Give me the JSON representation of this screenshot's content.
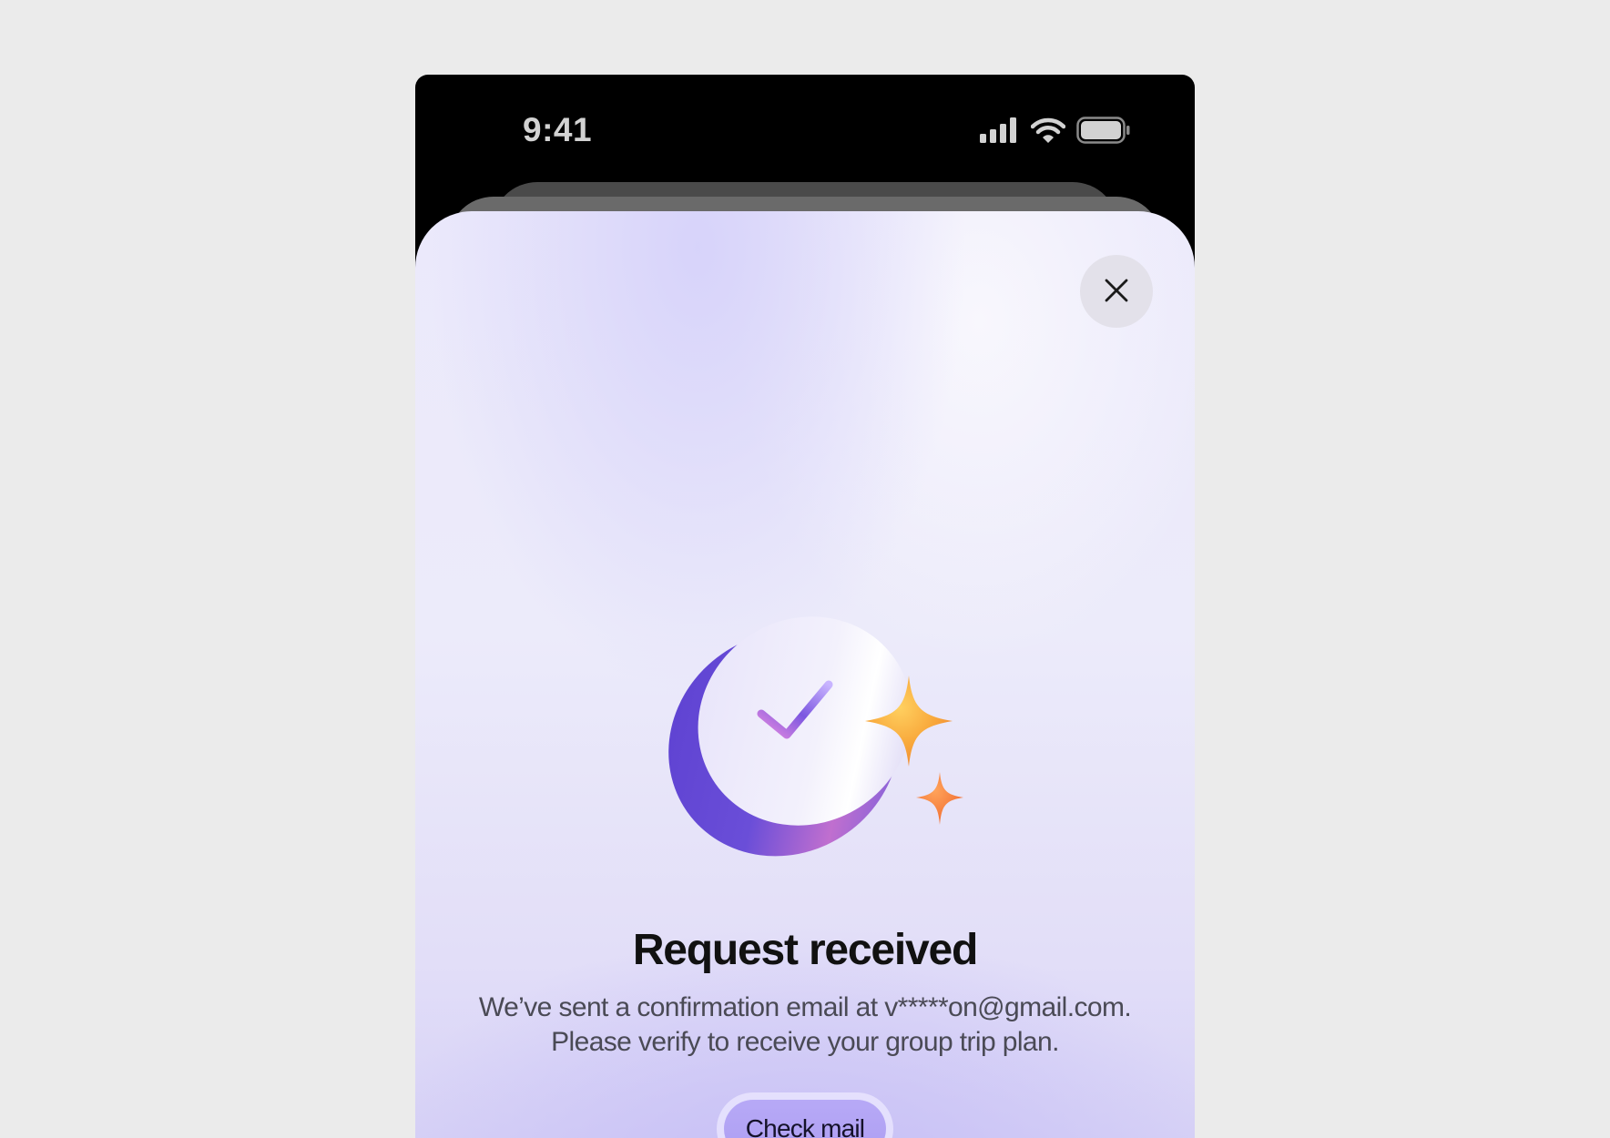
{
  "status_bar": {
    "time": "9:41",
    "icons": [
      "cellular-signal-icon",
      "wifi-icon",
      "battery-icon"
    ]
  },
  "modal": {
    "close_icon": "close-icon",
    "illustration": "check-badge-with-sparkles",
    "title": "Request received",
    "message_line_1": "We’ve sent a confirmation email at v*****on@gmail.com.",
    "message_line_2": "Please verify to receive your group trip plan.",
    "cta_label": "Check mail"
  },
  "colors": {
    "background": "#ebebeb",
    "device": "#000000",
    "sheet_top": "#ebe9fb",
    "sheet_bottom": "#d6d1f6",
    "button": "#b3a4f5",
    "title": "#111111",
    "body_text": "#4a4a55",
    "accent_purple": "#6a4ed8",
    "sparkle_orange": "#f7a23a"
  }
}
